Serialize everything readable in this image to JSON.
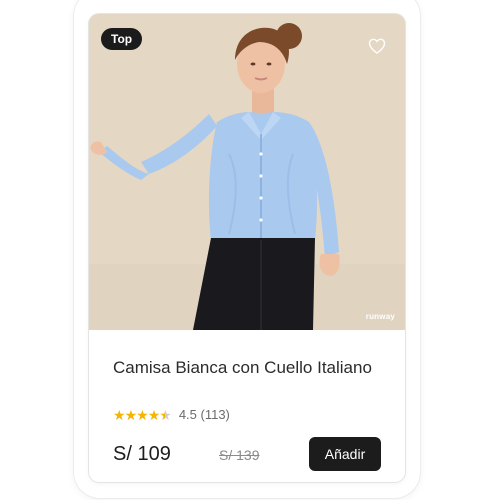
{
  "product": {
    "badge": "Top",
    "title": "Camisa Bianca con Cuello Italiano",
    "rating": 4.5,
    "rating_text": "4.5 (113)",
    "price": "S/ 109",
    "old_price": "S/ 139",
    "add_button_label": "Añadir",
    "watermark": "runway",
    "favorite_icon": "heart-outline-icon",
    "image_alt": "Mujer con camisa celeste de cuello italiano y pantalón negro"
  },
  "colors": {
    "photo_background": "#e3d6c3",
    "shirt": "#a9c9ef",
    "pants": "#1a1a1e",
    "star": "#f5b400",
    "button": "#1c1c1c",
    "badge": "#1b1b1b"
  }
}
